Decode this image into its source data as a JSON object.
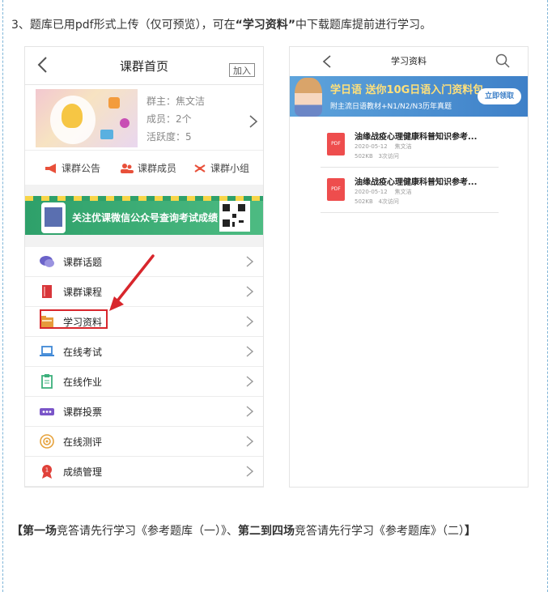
{
  "intro": {
    "prefix": "3、题库已用pdf形式上传（仅可预览），可在",
    "quote_open": "“",
    "emphasis": "学习资料",
    "quote_close": "”",
    "suffix": "中下载题库提前进行学习。"
  },
  "left_phone": {
    "title": "课群首页",
    "join_label": "加入",
    "info": {
      "owner": "群主：焦文洁",
      "members": "成员：2个",
      "activity": "活跃度：5"
    },
    "tabs": [
      "课群公告",
      "课群成员",
      "课群小组"
    ],
    "banner_text": "关注优课微信公众号查询考试成绩",
    "menu": [
      {
        "label": "课群话题",
        "icon": "chat-bubble-icon",
        "color": "#6b63c9"
      },
      {
        "label": "课群课程",
        "icon": "book-icon",
        "color": "#d8363a"
      },
      {
        "label": "学习资料",
        "icon": "folder-icon",
        "color": "#e69a3a"
      },
      {
        "label": "在线考试",
        "icon": "laptop-icon",
        "color": "#3f88d6"
      },
      {
        "label": "在线作业",
        "icon": "clipboard-icon",
        "color": "#3cb07c"
      },
      {
        "label": "课群投票",
        "icon": "ticket-icon",
        "color": "#7a55c8"
      },
      {
        "label": "在线测评",
        "icon": "target-icon",
        "color": "#e6a23c"
      },
      {
        "label": "成绩管理",
        "icon": "award-ribbon-icon",
        "color": "#e0413a"
      }
    ],
    "highlight_color": "#d8262c"
  },
  "right_phone": {
    "title": "学习资料",
    "banner": {
      "headline": "学日语 送你10G日语入门资料包",
      "subline": "附主流日语教材+N1/N2/N3历年真题",
      "cta": "立即领取"
    },
    "files": [
      {
        "title": "油缘战疫心理健康科普知识参考...",
        "date": "2020-05-12",
        "author": "焦文洁",
        "size": "502KB",
        "visits": "3次访问",
        "badge": "PDF"
      },
      {
        "title": "油缘战疫心理健康科普知识参考...",
        "date": "2020-05-12",
        "author": "焦文洁",
        "size": "502KB",
        "visits": "4次访问",
        "badge": "PDF"
      }
    ]
  },
  "footer": {
    "bracket_open": "【",
    "round1": "第一场",
    "text1": "竞答请先行学习《参考题库（一）》、",
    "round2": "第二到四场",
    "text2": "竞答请先行学习《参考题库》（二）",
    "bracket_close": "】"
  }
}
